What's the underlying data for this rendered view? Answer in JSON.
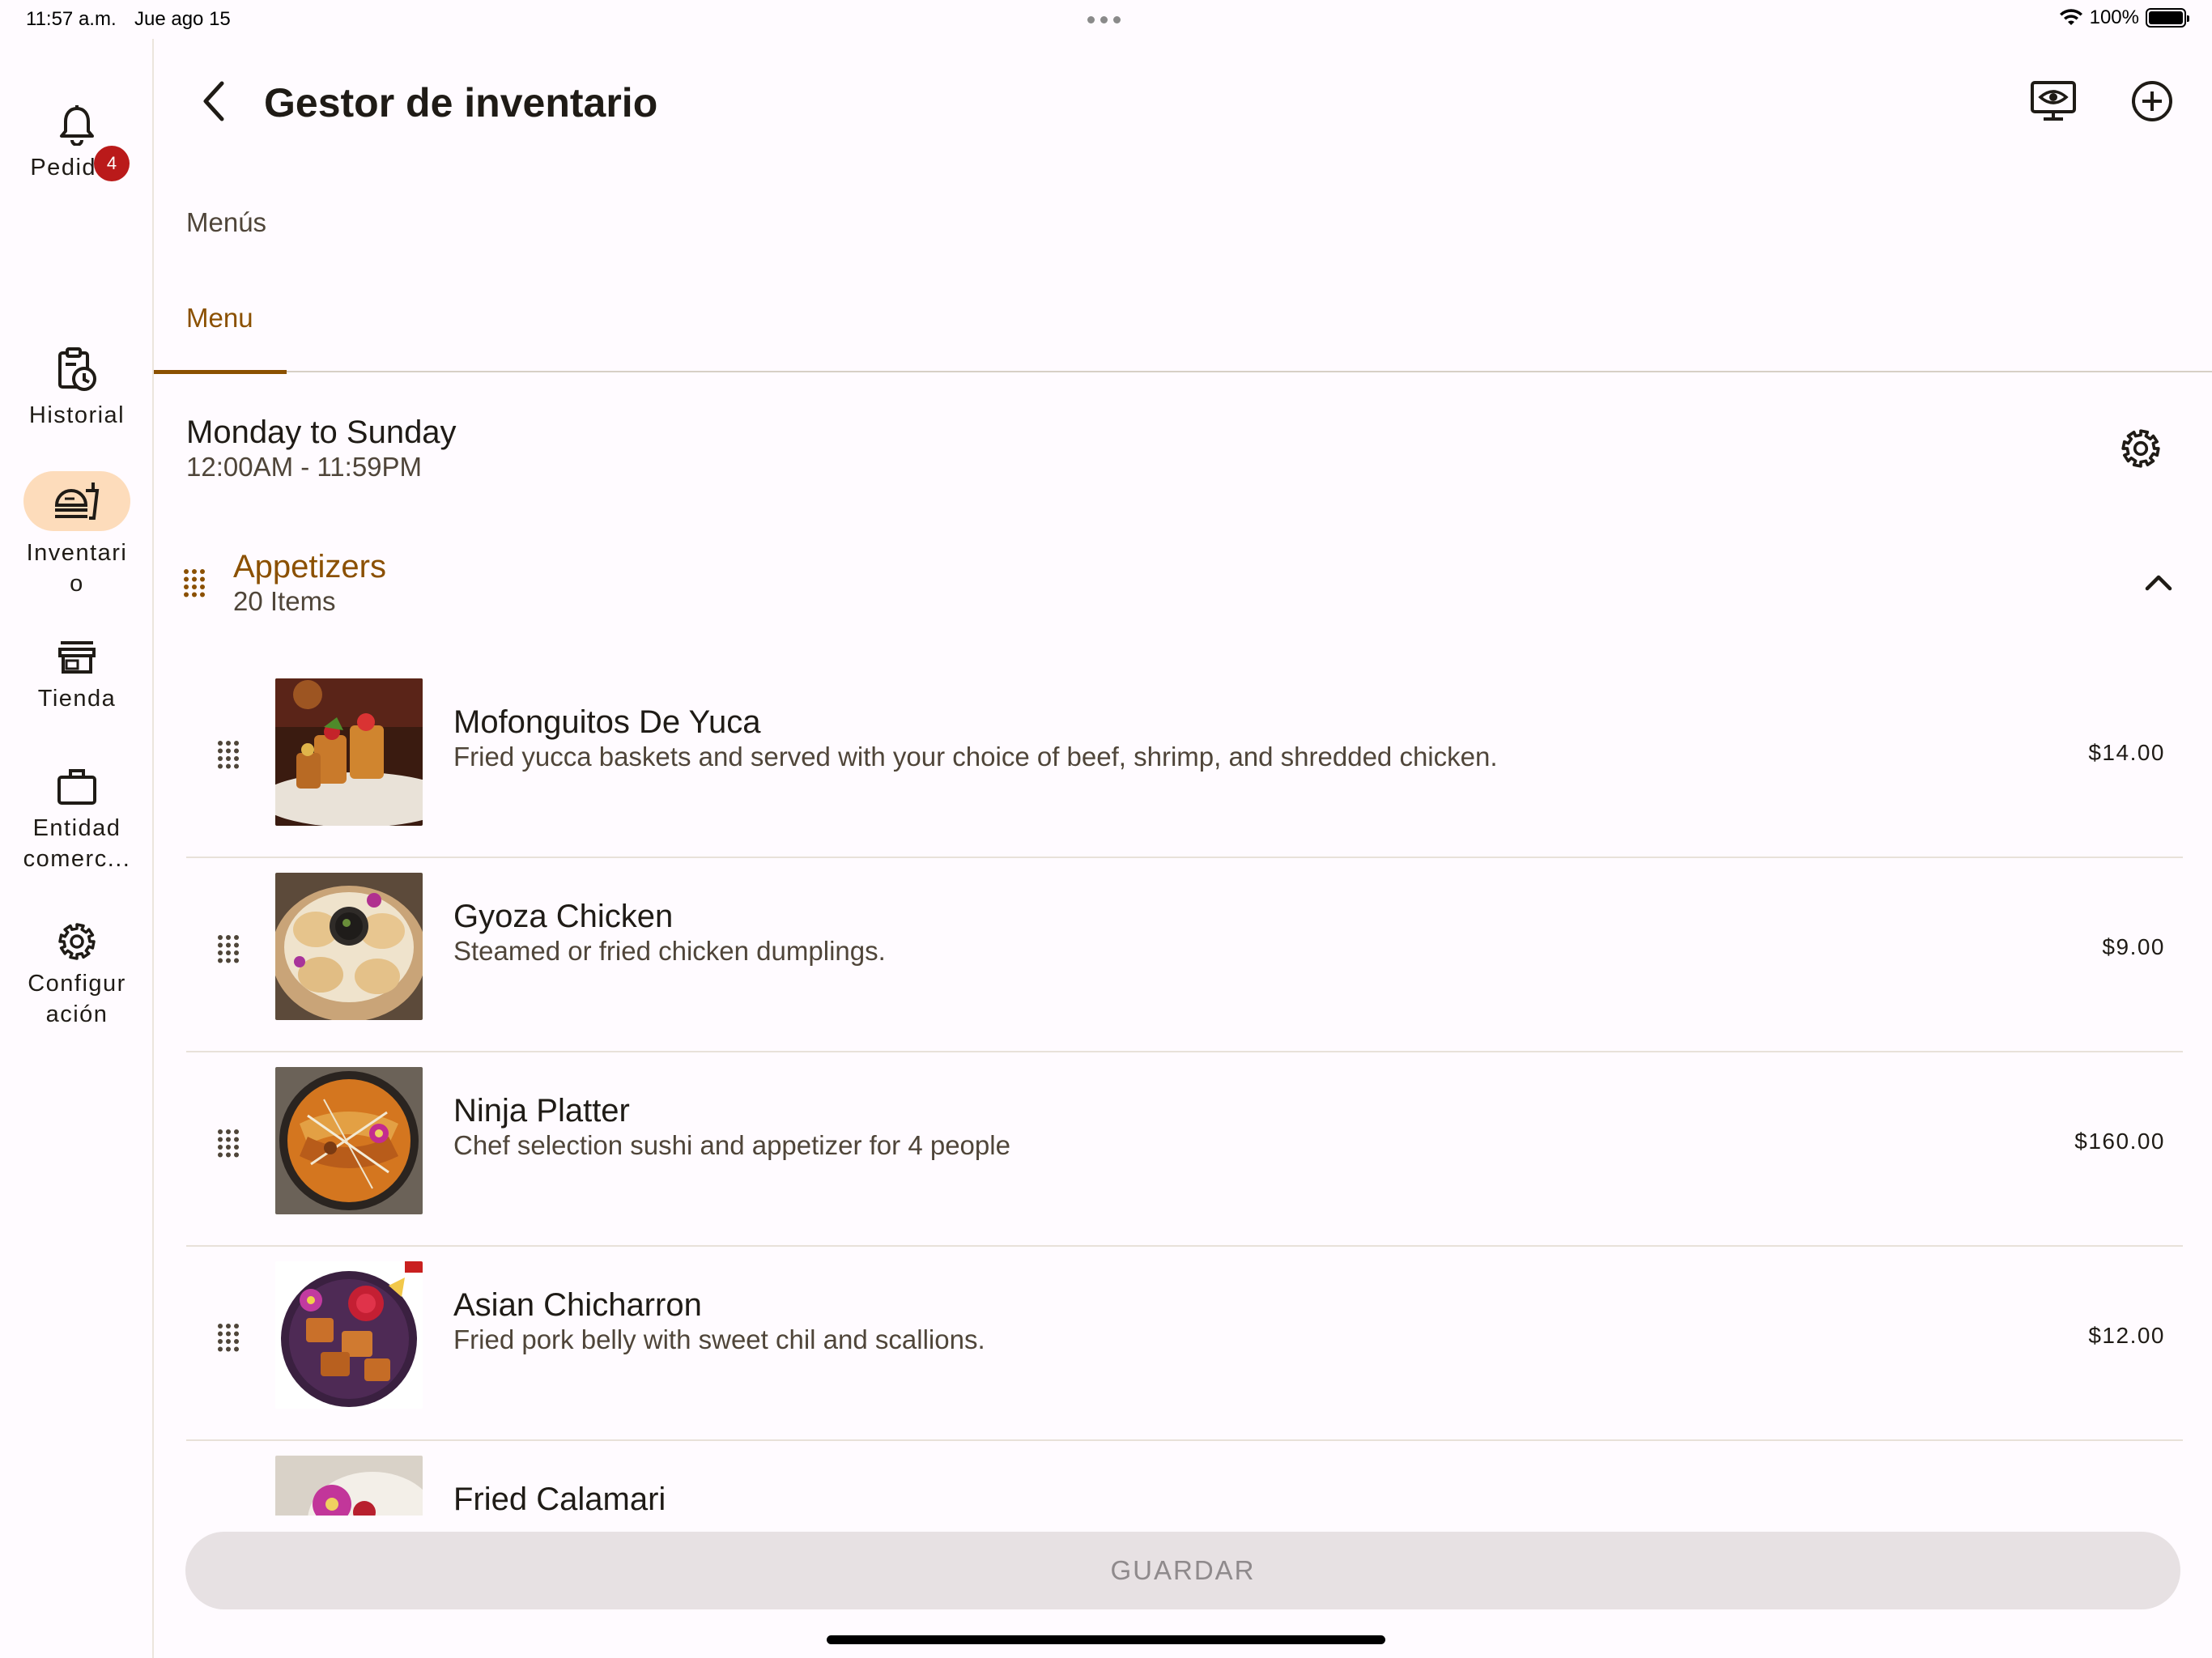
{
  "status_bar": {
    "time": "11:57 a.m.",
    "date": "Jue ago 15",
    "battery": "100%",
    "battery_level": 1.0
  },
  "rail": {
    "items": [
      {
        "label": "Pedidos",
        "icon": "bell-icon",
        "badge": "4"
      },
      {
        "label": "Historial",
        "icon": "history-clipboard-icon"
      },
      {
        "label": "Inventari o",
        "icon": "food-inventory-icon",
        "active": true
      },
      {
        "label": "Tienda",
        "icon": "storefront-icon"
      },
      {
        "label": "Entidad comerc...",
        "icon": "briefcase-icon"
      },
      {
        "label": "Configur ación",
        "icon": "gear-icon"
      }
    ]
  },
  "header": {
    "title": "Gestor de inventario",
    "back_icon": "chevron-left-icon",
    "preview_icon": "monitor-eye-icon",
    "add_icon": "plus-circle-icon"
  },
  "section_label": "Menús",
  "tabs": [
    {
      "label": "Menu",
      "active": true
    }
  ],
  "schedule": {
    "days": "Monday to Sunday",
    "hours": "12:00AM - 11:59PM",
    "settings_icon": "gear-icon"
  },
  "category": {
    "name": "Appetizers",
    "count": "20 Items",
    "expanded": true,
    "toggle_icon": "chevron-up-icon"
  },
  "items": [
    {
      "name": "Mofonguitos De Yuca",
      "description": "Fried yucca baskets and served with your choice of beef, shrimp, and shredded chicken.",
      "price": "$14.00"
    },
    {
      "name": "Gyoza Chicken",
      "description": "Steamed or fried chicken dumplings.",
      "price": "$9.00"
    },
    {
      "name": "Ninja Platter",
      "description": "Chef selection sushi and appetizer for 4 people",
      "price": "$160.00"
    },
    {
      "name": "Asian Chicharron",
      "description": "Fried pork belly with sweet chil and scallions.",
      "price": "$12.00"
    },
    {
      "name": "Fried Calamari",
      "description": "",
      "price": ""
    }
  ],
  "save_button": {
    "label": "GUARDAR",
    "enabled": false
  },
  "colors": {
    "accent": "#8b5000",
    "active_pill": "#fddcbb",
    "badge": "#ba1a1a",
    "background": "#fffbff",
    "disabled_button": "#e7e1e3"
  }
}
